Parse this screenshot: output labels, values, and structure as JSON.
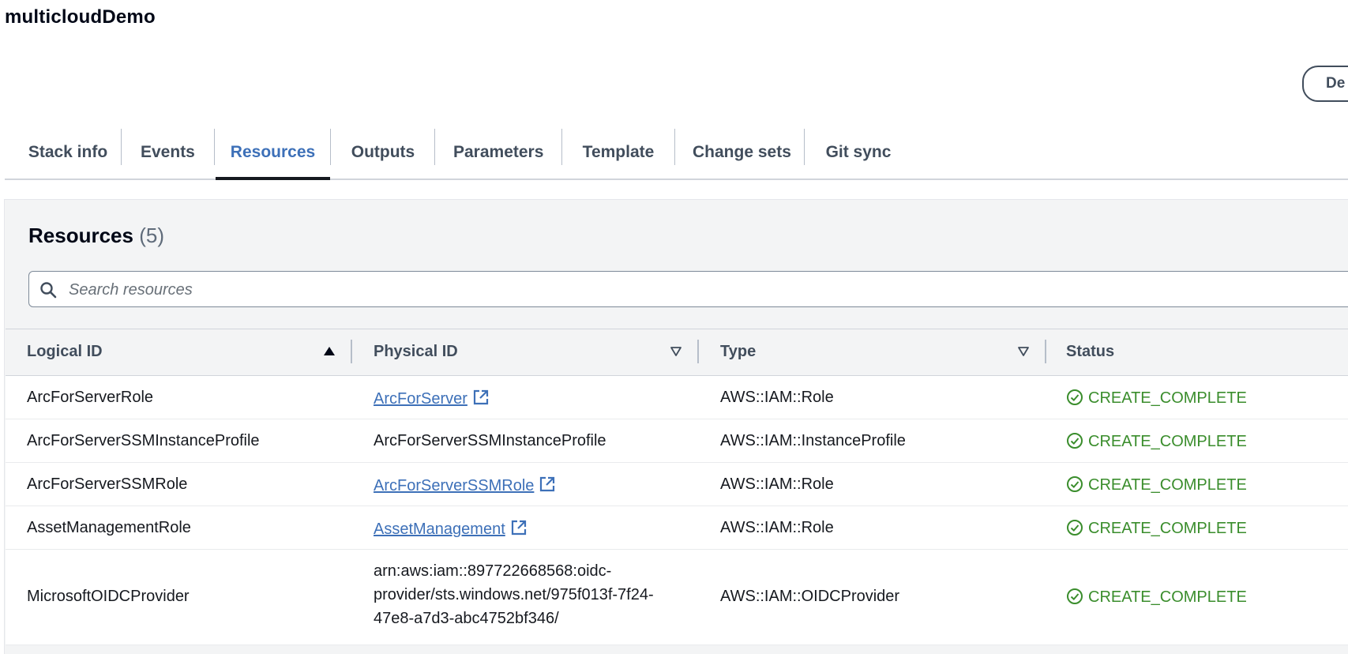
{
  "stack": {
    "title": "multicloudDemo",
    "top_button_label": "De"
  },
  "tabs": [
    {
      "label": "Stack info",
      "active": false
    },
    {
      "label": "Events",
      "active": false
    },
    {
      "label": "Resources",
      "active": true
    },
    {
      "label": "Outputs",
      "active": false
    },
    {
      "label": "Parameters",
      "active": false
    },
    {
      "label": "Template",
      "active": false
    },
    {
      "label": "Change sets",
      "active": false
    },
    {
      "label": "Git sync",
      "active": false
    }
  ],
  "resources": {
    "title": "Resources",
    "count": "(5)",
    "search": {
      "placeholder": "Search resources",
      "value": "",
      "icon": "search-icon"
    },
    "columns": [
      {
        "label": "Logical ID",
        "sort": "ascending",
        "sort_icon": "sort-ascending-icon"
      },
      {
        "label": "Physical ID",
        "sort": "none",
        "sort_icon": "sort-caret-down-icon"
      },
      {
        "label": "Type",
        "sort": "none",
        "sort_icon": "sort-caret-down-icon"
      },
      {
        "label": "Status"
      }
    ],
    "rows": [
      {
        "logical_id": "ArcForServerRole",
        "physical_id": "ArcForServer",
        "physical_is_link": true,
        "type": "AWS::IAM::Role",
        "status": "CREATE_COMPLETE"
      },
      {
        "logical_id": "ArcForServerSSMInstanceProfile",
        "physical_id": "ArcForServerSSMInstanceProfile",
        "physical_is_link": false,
        "type": "AWS::IAM::InstanceProfile",
        "status": "CREATE_COMPLETE"
      },
      {
        "logical_id": "ArcForServerSSMRole",
        "physical_id": "ArcForServerSSMRole",
        "physical_is_link": true,
        "type": "AWS::IAM::Role",
        "status": "CREATE_COMPLETE"
      },
      {
        "logical_id": "AssetManagementRole",
        "physical_id": "AssetManagement",
        "physical_is_link": true,
        "type": "AWS::IAM::Role",
        "status": "CREATE_COMPLETE"
      },
      {
        "logical_id": "MicrosoftOIDCProvider",
        "physical_id": "arn:aws:iam::897722668568:oidc-provider/sts.windows.net/975f013f-7f24-47e8-a7d3-abc4752bf346/",
        "physical_is_link": false,
        "type": "AWS::IAM::OIDCProvider",
        "status": "CREATE_COMPLETE"
      }
    ]
  },
  "colors": {
    "link": "#3d70b8",
    "active_tab": "#3d70b8",
    "status_success": "#3a8d2c",
    "panel_bg": "#f3f4f5"
  }
}
